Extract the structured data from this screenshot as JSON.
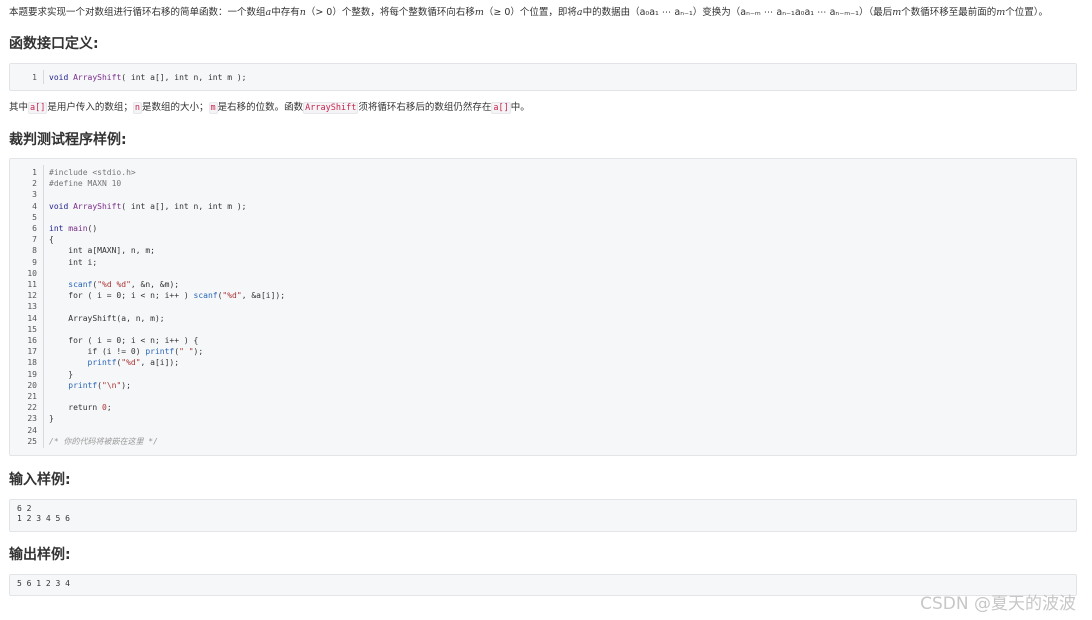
{
  "intro": {
    "p1": "本题要求实现一个对数组进行循环右移的简单函数：一个数组",
    "a1": "a",
    "p2": "中存有",
    "n1": "n",
    "p3": "（> 0）个整数，将每个整数循环向右移",
    "m1": "m",
    "p4": "（≥ 0）个位置，即将",
    "a2": "a",
    "p5": "中的数据由（a₀a₁ ⋯ aₙ₋₁）变换为（aₙ₋ₘ ⋯ aₙ₋₁a₀a₁ ⋯ aₙ₋ₘ₋₁）（最后",
    "m2": "m",
    "p6": "个数循环移至最前面的",
    "m3": "m",
    "p7": "个位置）。"
  },
  "sections": {
    "interface": "函数接口定义:",
    "judge": "裁判测试程序样例:",
    "input": "输入样例:",
    "output": "输出样例:"
  },
  "interface_code": {
    "line_no": "1",
    "kw1": "void",
    "fn": "ArrayShift",
    "rest": "( int a[], int n, int m );"
  },
  "description": {
    "t1": "其中",
    "c1": "a[]",
    "t2": "是用户传入的数组；",
    "c2": "n",
    "t3": "是数组的大小；",
    "c3": "m",
    "t4": "是右移的位数。函数",
    "c4": "ArrayShift",
    "t5": "须将循环右移后的数组仍然存在",
    "c5": "a[]",
    "t6": "中。"
  },
  "judge_code": {
    "line_numbers": [
      "1",
      "2",
      "3",
      "4",
      "5",
      "6",
      "7",
      "8",
      "9",
      "10",
      "11",
      "12",
      "13",
      "14",
      "15",
      "16",
      "17",
      "18",
      "19",
      "20",
      "21",
      "22",
      "23",
      "24",
      "25"
    ],
    "l1": "#include <stdio.h>",
    "l2": "#define MAXN 10",
    "l4_kw": "void",
    "l4_fn": "ArrayShift",
    "l4_rest": "( int a[], int n, int m );",
    "l6_kw": "int",
    "l6_fn": "main",
    "l6_rest": "()",
    "l7": "{",
    "l8": "    int a[MAXN], n, m;",
    "l9": "    int i;",
    "l11_io": "scanf",
    "l11_str": "\"%d %d\"",
    "l11_rest": ", &n, &m);",
    "l12_a": "    for ( i = 0; i < n; i++ ) ",
    "l12_io": "scanf",
    "l12_p": "(",
    "l12_str": "\"%d\"",
    "l12_rest": ", &a[i]);",
    "l14": "    ArrayShift(a, n, m);",
    "l16": "    for ( i = 0; i < n; i++ ) {",
    "l17_a": "        if (i != 0) ",
    "l17_io": "printf",
    "l17_p": "(",
    "l17_str": "\" \"",
    "l17_rest": ");",
    "l18_io": "printf",
    "l18_p": "(",
    "l18_str": "\"%d\"",
    "l18_rest": ", a[i]);",
    "l19": "    }",
    "l20_io": "printf",
    "l20_p": "(",
    "l20_str": "\"\\n\"",
    "l20_rest": ");",
    "l22_a": "    return ",
    "l22_num": "0",
    "l22_rest": ";",
    "l23": "}",
    "l25": "/* 你的代码将被嵌在这里 */"
  },
  "input_sample": "6 2\n1 2 3 4 5 6",
  "output_sample": "5 6 1 2 3 4",
  "watermark": "CSDN @夏天的波波"
}
